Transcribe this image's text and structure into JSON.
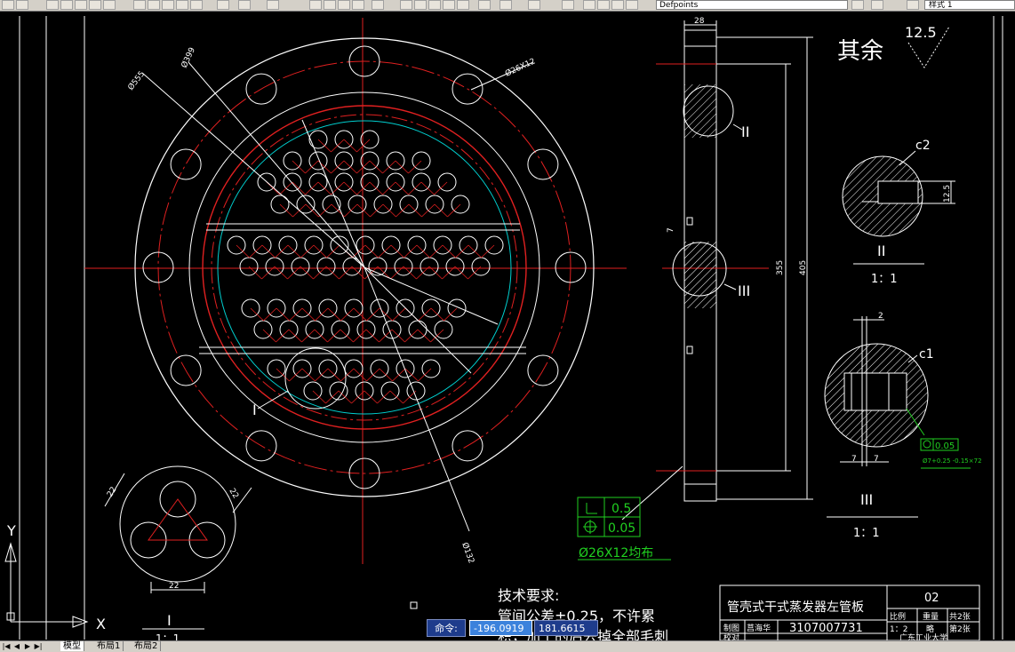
{
  "toolbar": {
    "layer_name": "Defpoints",
    "text_style": "样式 1"
  },
  "drawing": {
    "remainder_label": "其余",
    "roughness_value": "12.5",
    "label_c2": "c2",
    "label_c1": "c1",
    "roman_II": "II",
    "roman_III": "III",
    "roman_I": "I",
    "scale_II": "1：1",
    "scale_III": "1：1",
    "scale_I": "1：1",
    "dim_28": "28",
    "dim_355": "355",
    "dim_405": "405",
    "dim_12_5": "12.5",
    "dim_2": "2",
    "dim_7a": "7",
    "dim_7b": "7",
    "dim_7c": "7",
    "dim_22a": "22",
    "dim_22b": "22",
    "dim_22c": "22",
    "dia_555": "Ø555",
    "dia_399": "Ø399",
    "dia_26x12": "Ø26X12",
    "dia_132": "Ø132",
    "tol_flat": "0.5",
    "tol_pos": "0.05",
    "hole_note": "Ø26X12均布",
    "tol_small_pos": "0.05",
    "tol_small_note": "Ø7+0.25 -0.15×72",
    "tech_title": "技术要求:",
    "tech_line1": "管间公差±0.25，不许累",
    "tech_line2": "积，加工的后去掉全部毛刺",
    "title_block": {
      "part_name": "管壳式干式蒸发器左管板",
      "number": "02",
      "col_scale": "比例",
      "col_weight": "重量",
      "col_total": "共2张",
      "scale_val": "1：2",
      "weight_val": "略",
      "sheet": "第2张",
      "row_drawn": "制图",
      "drawer": "莒海华",
      "drawing_code": "3107007731",
      "row_check": "校对",
      "school": "广东工业大学"
    },
    "ucs_y": "Y",
    "ucs_x": "X"
  },
  "command": {
    "prompt": "命令:",
    "x_value": "-196.0919",
    "y_value": "181.6615"
  },
  "tabs": [
    "模型",
    "布局1",
    "布局2"
  ]
}
